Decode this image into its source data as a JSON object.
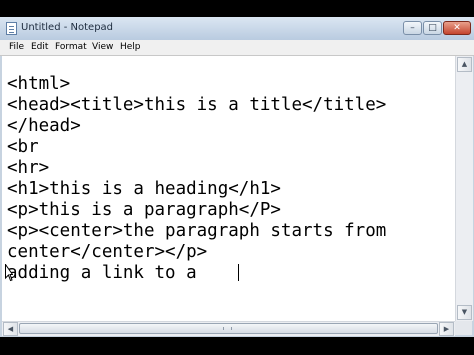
{
  "window": {
    "title": "Untitled - Notepad",
    "controls": {
      "minimize": "–",
      "maximize": "□",
      "close": "✕"
    }
  },
  "menu": [
    "File",
    "Edit",
    "Format",
    "View",
    "Help"
  ],
  "editor": {
    "lines": [
      "<html>",
      "<head><title>this is a title</title>",
      "</head>",
      "<br",
      "<hr>",
      "<h1>this is a heading</h1>",
      "<p>this is a paragraph</P>",
      "<p><center>the paragraph starts from",
      "center</center></p>",
      "adding a link to a "
    ]
  },
  "icons": {
    "app": "notepad-icon",
    "cursor": "mouse-pointer-icon",
    "scroll_up": "▲",
    "scroll_down": "▼",
    "scroll_left": "◀",
    "scroll_right": "▶"
  }
}
